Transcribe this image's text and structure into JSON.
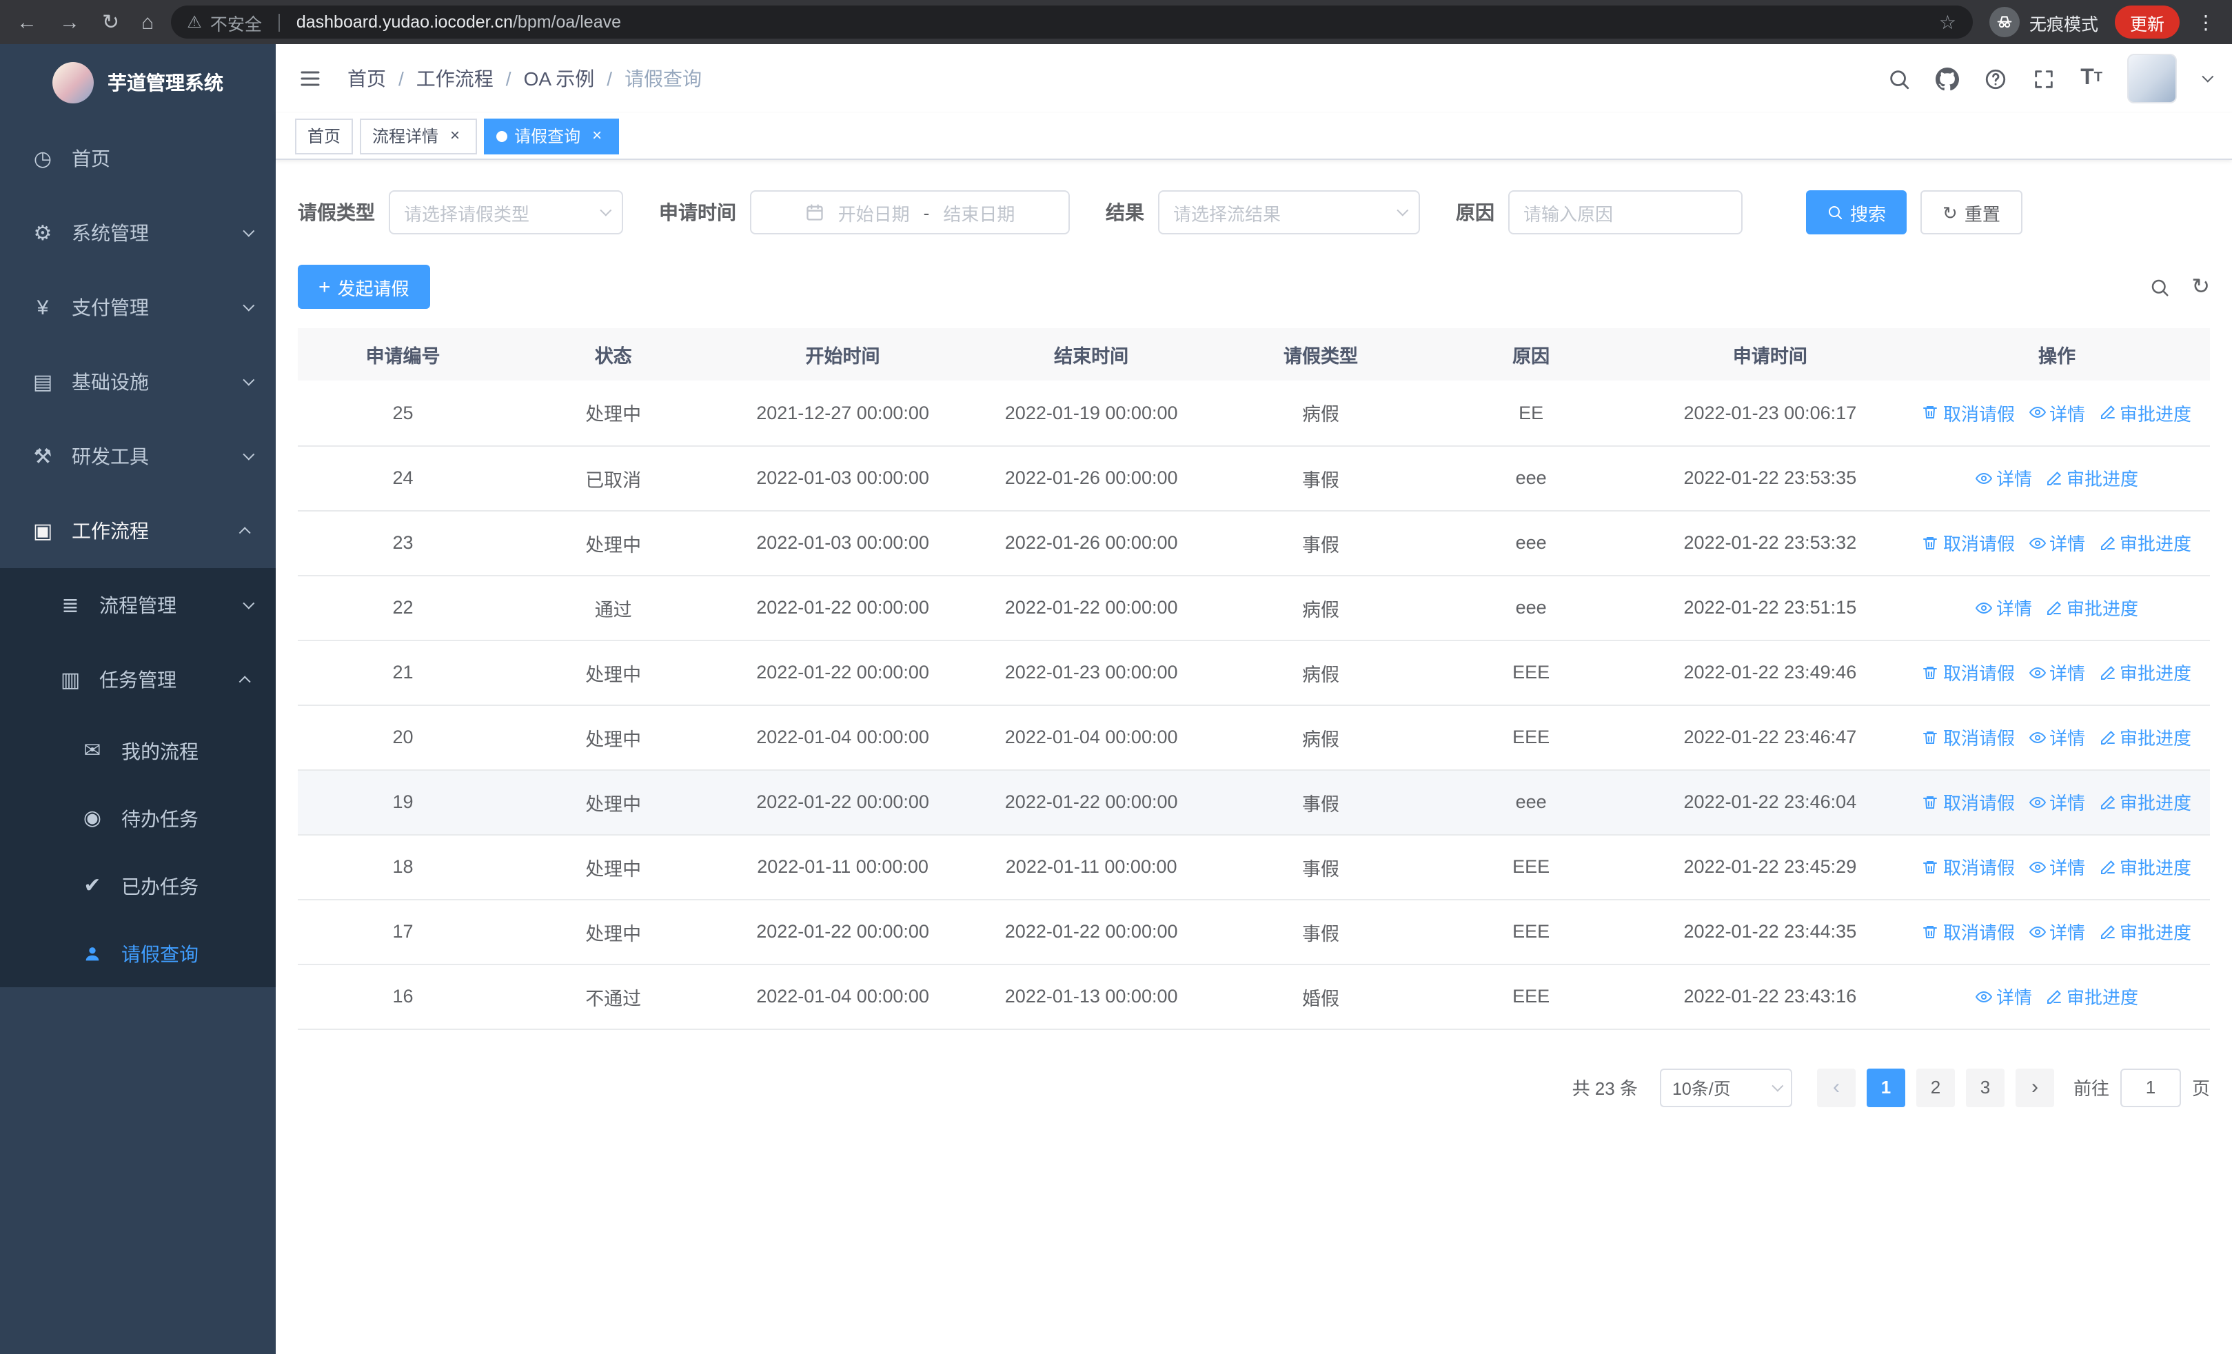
{
  "browser": {
    "security_label": "不安全",
    "url_domain": "dashboard.yudao.iocoder.cn",
    "url_path": "/bpm/oa/leave",
    "incognito_label": "无痕模式",
    "update_label": "更新"
  },
  "icons": {
    "back": "←",
    "forward": "→",
    "reload": "↻",
    "home": "⌂",
    "warning": "⚠",
    "star": "☆",
    "more_vertical": "⋮",
    "close": "×",
    "dashboard": "◷",
    "gear": "⚙",
    "yen": "¥",
    "infrastructure": "▤",
    "tools": "⚒",
    "workflow": "▣",
    "process_mgmt": "≣",
    "task_mgmt": "▥",
    "my_process": "✉",
    "todo": "◉",
    "done": "✔",
    "refresh": "↻",
    "plus": "+",
    "chevron_left": "‹",
    "chevron_right": "›"
  },
  "sidebar": {
    "logo_title": "芋道管理系统",
    "items": [
      {
        "label": "首页"
      },
      {
        "label": "系统管理"
      },
      {
        "label": "支付管理"
      },
      {
        "label": "基础设施"
      },
      {
        "label": "研发工具"
      },
      {
        "label": "工作流程"
      }
    ],
    "submenu": [
      {
        "label": "流程管理"
      },
      {
        "label": "任务管理"
      }
    ],
    "task_items": [
      {
        "label": "我的流程"
      },
      {
        "label": "待办任务"
      },
      {
        "label": "已办任务"
      },
      {
        "label": "请假查询"
      }
    ]
  },
  "header": {
    "breadcrumb": [
      {
        "label": "首页"
      },
      {
        "label": "工作流程"
      },
      {
        "label": "OA 示例"
      },
      {
        "label": "请假查询"
      }
    ]
  },
  "tags": [
    {
      "label": "首页",
      "closable": false,
      "active": false
    },
    {
      "label": "流程详情",
      "closable": true,
      "active": false
    },
    {
      "label": "请假查询",
      "closable": true,
      "active": true
    }
  ],
  "filters": {
    "leave_type_label": "请假类型",
    "leave_type_placeholder": "请选择请假类型",
    "apply_time_label": "申请时间",
    "start_date_placeholder": "开始日期",
    "range_separator": "-",
    "end_date_placeholder": "结束日期",
    "result_label": "结果",
    "result_placeholder": "请选择流结果",
    "reason_label": "原因",
    "reason_placeholder": "请输入原因",
    "search_button": "搜索",
    "reset_button": "重置"
  },
  "toolbar": {
    "create_button": "发起请假"
  },
  "table": {
    "columns": [
      "申请编号",
      "状态",
      "开始时间",
      "结束时间",
      "请假类型",
      "原因",
      "申请时间",
      "操作"
    ],
    "action_labels": {
      "cancel": "取消请假",
      "detail": "详情",
      "progress": "审批进度"
    },
    "rows": [
      {
        "id": "25",
        "status": "处理中",
        "start": "2021-12-27 00:00:00",
        "end": "2022-01-19 00:00:00",
        "type": "病假",
        "reason": "EE",
        "apply": "2022-01-23 00:06:17",
        "cancellable": true,
        "highlighted": false
      },
      {
        "id": "24",
        "status": "已取消",
        "start": "2022-01-03 00:00:00",
        "end": "2022-01-26 00:00:00",
        "type": "事假",
        "reason": "eee",
        "apply": "2022-01-22 23:53:35",
        "cancellable": false,
        "highlighted": false
      },
      {
        "id": "23",
        "status": "处理中",
        "start": "2022-01-03 00:00:00",
        "end": "2022-01-26 00:00:00",
        "type": "事假",
        "reason": "eee",
        "apply": "2022-01-22 23:53:32",
        "cancellable": true,
        "highlighted": false
      },
      {
        "id": "22",
        "status": "通过",
        "start": "2022-01-22 00:00:00",
        "end": "2022-01-22 00:00:00",
        "type": "病假",
        "reason": "eee",
        "apply": "2022-01-22 23:51:15",
        "cancellable": false,
        "highlighted": false
      },
      {
        "id": "21",
        "status": "处理中",
        "start": "2022-01-22 00:00:00",
        "end": "2022-01-23 00:00:00",
        "type": "病假",
        "reason": "EEE",
        "apply": "2022-01-22 23:49:46",
        "cancellable": true,
        "highlighted": false
      },
      {
        "id": "20",
        "status": "处理中",
        "start": "2022-01-04 00:00:00",
        "end": "2022-01-04 00:00:00",
        "type": "病假",
        "reason": "EEE",
        "apply": "2022-01-22 23:46:47",
        "cancellable": true,
        "highlighted": false
      },
      {
        "id": "19",
        "status": "处理中",
        "start": "2022-01-22 00:00:00",
        "end": "2022-01-22 00:00:00",
        "type": "事假",
        "reason": "eee",
        "apply": "2022-01-22 23:46:04",
        "cancellable": true,
        "highlighted": true
      },
      {
        "id": "18",
        "status": "处理中",
        "start": "2022-01-11 00:00:00",
        "end": "2022-01-11 00:00:00",
        "type": "事假",
        "reason": "EEE",
        "apply": "2022-01-22 23:45:29",
        "cancellable": true,
        "highlighted": false
      },
      {
        "id": "17",
        "status": "处理中",
        "start": "2022-01-22 00:00:00",
        "end": "2022-01-22 00:00:00",
        "type": "事假",
        "reason": "EEE",
        "apply": "2022-01-22 23:44:35",
        "cancellable": true,
        "highlighted": false
      },
      {
        "id": "16",
        "status": "不通过",
        "start": "2022-01-04 00:00:00",
        "end": "2022-01-13 00:00:00",
        "type": "婚假",
        "reason": "EEE",
        "apply": "2022-01-22 23:43:16",
        "cancellable": false,
        "highlighted": false
      }
    ]
  },
  "pagination": {
    "total_text": "共 23 条",
    "page_size_text": "10条/页",
    "pages": [
      "1",
      "2",
      "3"
    ],
    "active_page": "1",
    "goto_prefix": "前往",
    "goto_value": "1",
    "goto_suffix": "页"
  },
  "colors": {
    "primary": "#409eff",
    "sidebar_bg": "#304156",
    "submenu_bg": "#1f2d3d",
    "update_badge": "#d93025"
  }
}
